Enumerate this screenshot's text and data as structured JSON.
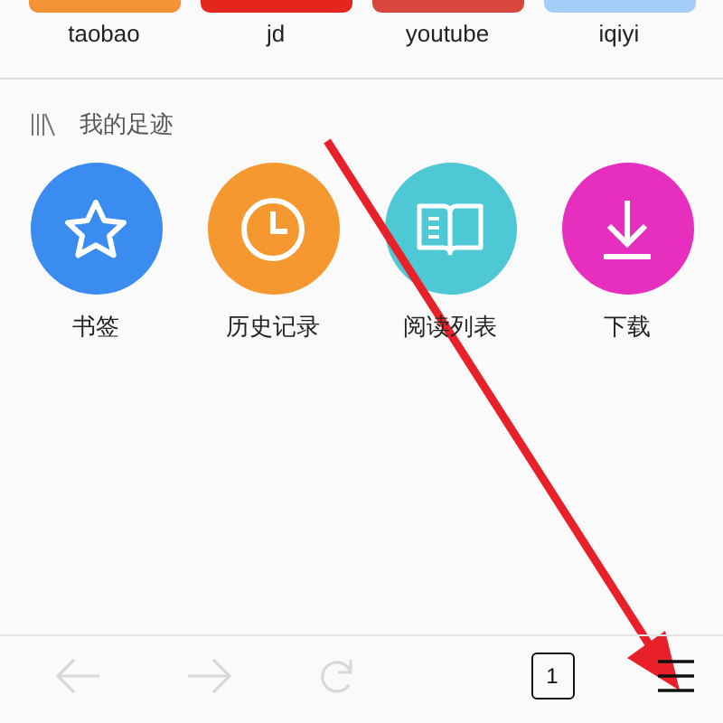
{
  "shortcuts": [
    {
      "label": "taobao",
      "color": "#f39237"
    },
    {
      "label": "jd",
      "color": "#e5261f"
    },
    {
      "label": "youtube",
      "color": "#d9463e"
    },
    {
      "label": "iqiyi",
      "color": "#a4cdf8"
    }
  ],
  "footprints": {
    "title": "我的足迹",
    "items": [
      {
        "label": "书签",
        "kind": "star",
        "color": "#3b8cf0"
      },
      {
        "label": "历史记录",
        "kind": "clock",
        "color": "#f4982f"
      },
      {
        "label": "阅读列表",
        "kind": "book",
        "color": "#4fc8d6"
      },
      {
        "label": "下载",
        "kind": "download",
        "color": "#e62fbf"
      }
    ]
  },
  "toolbar": {
    "back": {
      "disabled": true
    },
    "forward": {
      "disabled": true
    },
    "reload": {
      "disabled": true
    },
    "tab_count": "1"
  }
}
